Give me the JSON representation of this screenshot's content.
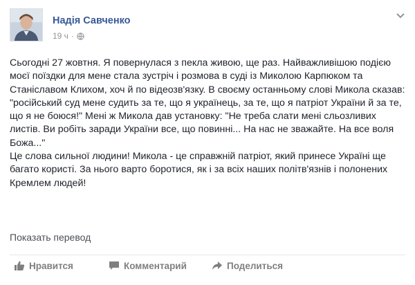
{
  "post": {
    "author": "Надія Савченко",
    "time": "19 ч",
    "separator": "·",
    "icons": {
      "privacy": "globe-icon",
      "menu": "chevron-down-icon",
      "avatar": "profile-photo"
    },
    "paragraphs": [
      "Сьогодні 27 жовтня. Я повернулася з пекла живою, ще раз. Найважливішою подією моєї поїздки для мене стала зустріч і розмова в суді із Миколою Карпюком та Станіславом Клихом, хоч й по відеозв'язку. В своєму останньому слові Микола сказав: \"російський суд мене судить за те, що я українець, за те, що я патріот України й за те, що я не боюся!\" Мені ж Микола дав установку: \"Не треба слати мені сльозливих листів. Ви робіть заради України все, що повинні... На нас не зважайте. На все воля Божа...\"",
      "Це слова сильної людини! Микола - це справжній патріот, який принесе Україні ще багато користі. За нього варто боротися, як і за всіх наших політв'язнів і полонених Кремлем людей!"
    ],
    "translate_link": "Показать перевод"
  },
  "actions": {
    "like": {
      "label": "Нравится",
      "icon": "thumbs-up-icon"
    },
    "comment": {
      "label": "Комментарий",
      "icon": "comment-icon"
    },
    "share": {
      "label": "Поделиться",
      "icon": "share-icon"
    }
  },
  "colors": {
    "author_link": "#365899",
    "meta_gray": "#90949c",
    "action_gray": "#7f7f7f",
    "text": "#1d2129"
  }
}
